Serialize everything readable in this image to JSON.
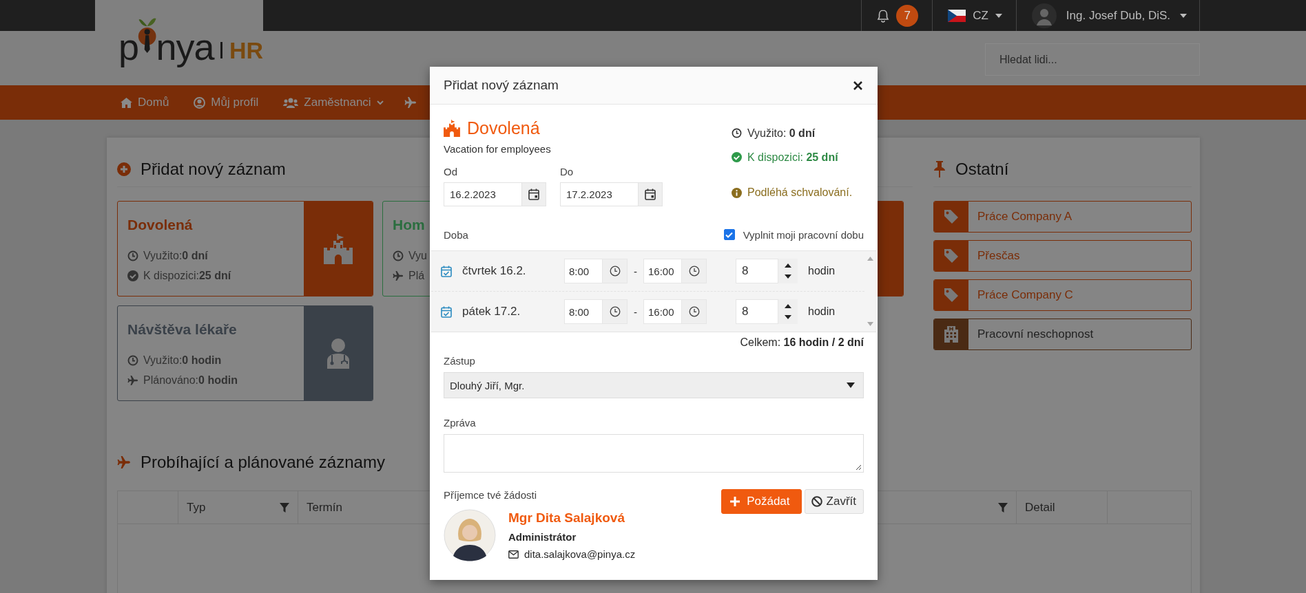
{
  "top_bar": {
    "notifications": "7",
    "language": "CZ",
    "user": "Ing. Josef Dub, DiS."
  },
  "logo": {
    "before": "p",
    "after": "nya",
    "suffix": "HR"
  },
  "search": {
    "placeholder": "Hledat lidi..."
  },
  "nav": [
    {
      "label": "Domů",
      "dropdown": false
    },
    {
      "label": "Můj profil",
      "dropdown": false
    },
    {
      "label": "Zaměstnanci",
      "dropdown": true
    }
  ],
  "add_section": {
    "title": "Přidat nový záznam",
    "cards": [
      {
        "kind": "vacation",
        "title": "Dovolená",
        "color": "#7a2d08",
        "lines": [
          {
            "kind": "used",
            "label": "Využito:",
            "value": "0 dní"
          },
          {
            "kind": "available",
            "label": "K dispozici:",
            "value": "25 dní"
          }
        ]
      },
      {
        "kind": "home",
        "title": "Hom",
        "color": "#2b6e3f",
        "lines": [
          {
            "kind": "used",
            "label": "Vyu"
          },
          {
            "kind": "planned",
            "label": "Plá"
          }
        ]
      },
      {
        "kind": "other",
        "color": "#7a2d08"
      },
      {
        "kind": "doctor",
        "title": "Návštěva lékaře",
        "color": "#3a4149",
        "lines": [
          {
            "kind": "used",
            "label": "Využito:",
            "value": "0 hodin"
          },
          {
            "kind": "planned",
            "label": "Plánováno:",
            "value": "0 hodin"
          }
        ]
      }
    ]
  },
  "other": {
    "title": "Ostatní",
    "items": [
      {
        "kind": "tag",
        "label": "Práce Company A",
        "color": "#7a2d08"
      },
      {
        "kind": "tag",
        "label": "Přesčas",
        "color": "#7a2d08"
      },
      {
        "kind": "tag",
        "label": "Práce Company C",
        "color": "#7a2d08"
      },
      {
        "kind": "hospital",
        "label": "Pracovní neschopnost",
        "color": "#4a2a14"
      }
    ]
  },
  "records": {
    "title": "Probíhající a plánované záznamy",
    "columns": [
      {
        "label": "Typ",
        "filter": true
      },
      {
        "label": "Termín"
      },
      {
        "filter": true
      },
      {
        "label": "Detail",
        "filter": false
      }
    ]
  },
  "modal": {
    "title": "Přidat nový záznam",
    "type": {
      "name": "Dovolená",
      "description": "Vacation for employees"
    },
    "stats": [
      {
        "kind": "used",
        "label": "Využito:",
        "value": "0 dní"
      },
      {
        "kind": "available",
        "label": "K dispozici:",
        "value": "25 dní"
      }
    ],
    "approval_note": "Podléhá schvalování.",
    "from": {
      "label": "Od",
      "value": "16.2.2023"
    },
    "to": {
      "label": "Do",
      "value": "17.2.2023"
    },
    "duration_label": "Doba",
    "fill_work_hours": {
      "label": "Vyplnit moji pracovní dobu",
      "checked": true
    },
    "days": [
      {
        "day": "čtvrtek 16.2.",
        "start": "8:00",
        "separator": "-",
        "end": "16:00",
        "hours": "8",
        "unit": "hodin"
      },
      {
        "day": "pátek 17.2.",
        "start": "8:00",
        "separator": "-",
        "end": "16:00",
        "hours": "8",
        "unit": "hodin"
      }
    ],
    "total": {
      "label": "Celkem:",
      "value": "16 hodin / 2 dní"
    },
    "substitute": {
      "label": "Zástup",
      "value": "Dlouhý Jiří, Mgr."
    },
    "message": {
      "label": "Zpráva"
    },
    "recipient": {
      "label": "Příjemce tvé žádosti",
      "name": "Mgr Dita Salajková",
      "role": "Administrátor",
      "email": "dita.salajkova@pinya.cz"
    },
    "buttons": [
      {
        "kind": "primary",
        "label": "Požádat"
      },
      {
        "kind": "secondary",
        "label": "Zavřít"
      }
    ]
  }
}
